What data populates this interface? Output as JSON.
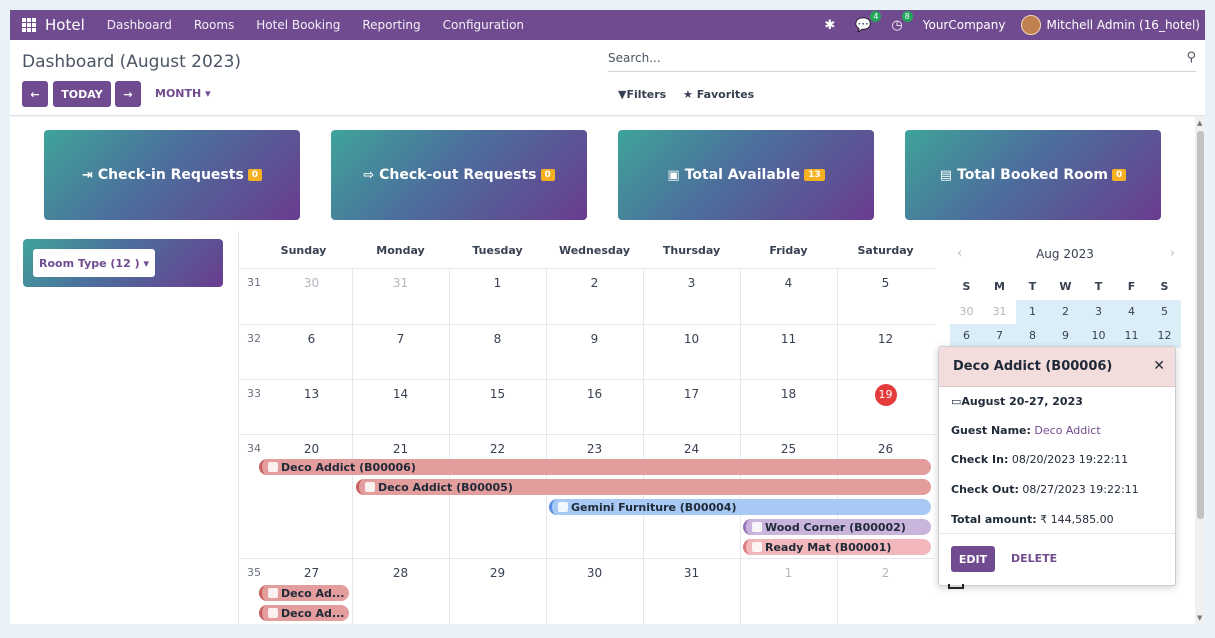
{
  "navbar": {
    "app_name": "Hotel",
    "menu": [
      "Dashboard",
      "Rooms",
      "Hotel Booking",
      "Reporting",
      "Configuration"
    ],
    "messages_count": "4",
    "activities_count": "8",
    "company": "YourCompany",
    "user": "Mitchell Admin (16_hotel)"
  },
  "control": {
    "title": "Dashboard (August 2023)",
    "today_label": "TODAY",
    "month_label": "MONTH",
    "search_placeholder": "Search...",
    "filters_label": "Filters",
    "favorites_label": "Favorites"
  },
  "cards": [
    {
      "label": "Check-in Requests",
      "count": "0",
      "icon": "sign-in-icon"
    },
    {
      "label": "Check-out Requests",
      "count": "0",
      "icon": "sign-out-icon"
    },
    {
      "label": "Total Available",
      "count": "13",
      "icon": "calendar-check-icon"
    },
    {
      "label": "Total Booked Room",
      "count": "0",
      "icon": "building-icon"
    }
  ],
  "room_type": {
    "label": "Room Type (12 )"
  },
  "calendar": {
    "day_names": [
      "Sunday",
      "Monday",
      "Tuesday",
      "Wednesday",
      "Thursday",
      "Friday",
      "Saturday"
    ],
    "weeks": [
      {
        "num": "31",
        "days": [
          "30",
          "31",
          "1",
          "2",
          "3",
          "4",
          "5"
        ]
      },
      {
        "num": "32",
        "days": [
          "6",
          "7",
          "8",
          "9",
          "10",
          "11",
          "12"
        ]
      },
      {
        "num": "33",
        "days": [
          "13",
          "14",
          "15",
          "16",
          "17",
          "18",
          "19"
        ]
      },
      {
        "num": "34",
        "days": [
          "20",
          "21",
          "22",
          "23",
          "24",
          "25",
          "26"
        ]
      },
      {
        "num": "35",
        "days": [
          "27",
          "28",
          "29",
          "30",
          "31",
          "1",
          "2"
        ]
      }
    ],
    "today": "19",
    "events": [
      {
        "label": "Deco Addict (B00006)",
        "color": "#e39d9d"
      },
      {
        "label": "Deco Addict (B00005)",
        "color": "#e39d9d"
      },
      {
        "label": "Gemini Furniture (B00004)",
        "color": "#a7c9f3"
      },
      {
        "label": "Wood Corner (B00002)",
        "color": "#c9b4dc"
      },
      {
        "label": "Ready Mat (B00001)",
        "color": "#f1b7ba"
      },
      {
        "label": "Deco Ad...",
        "color": "#e39d9d"
      },
      {
        "label": "Deco Ad...",
        "color": "#e39d9d"
      }
    ]
  },
  "mini_calendar": {
    "title": "Aug 2023",
    "day_letters": [
      "S",
      "M",
      "T",
      "W",
      "T",
      "F",
      "S"
    ],
    "rows": [
      [
        "30",
        "31",
        "1",
        "2",
        "3",
        "4",
        "5"
      ],
      [
        "6",
        "7",
        "8",
        "9",
        "10",
        "11",
        "12"
      ]
    ]
  },
  "popover": {
    "title": "Deco Addict (B00006)",
    "dates": "August 20-27, 2023",
    "guest_label": "Guest Name:",
    "guest_value": "Deco Addict",
    "checkin_label": "Check In:",
    "checkin_value": "08/20/2023 19:22:11",
    "checkout_label": "Check Out:",
    "checkout_value": "08/27/2023 19:22:11",
    "amount_label": "Total amount:",
    "amount_value": "₹ 144,585.00",
    "edit_label": "EDIT",
    "delete_label": "DELETE"
  }
}
